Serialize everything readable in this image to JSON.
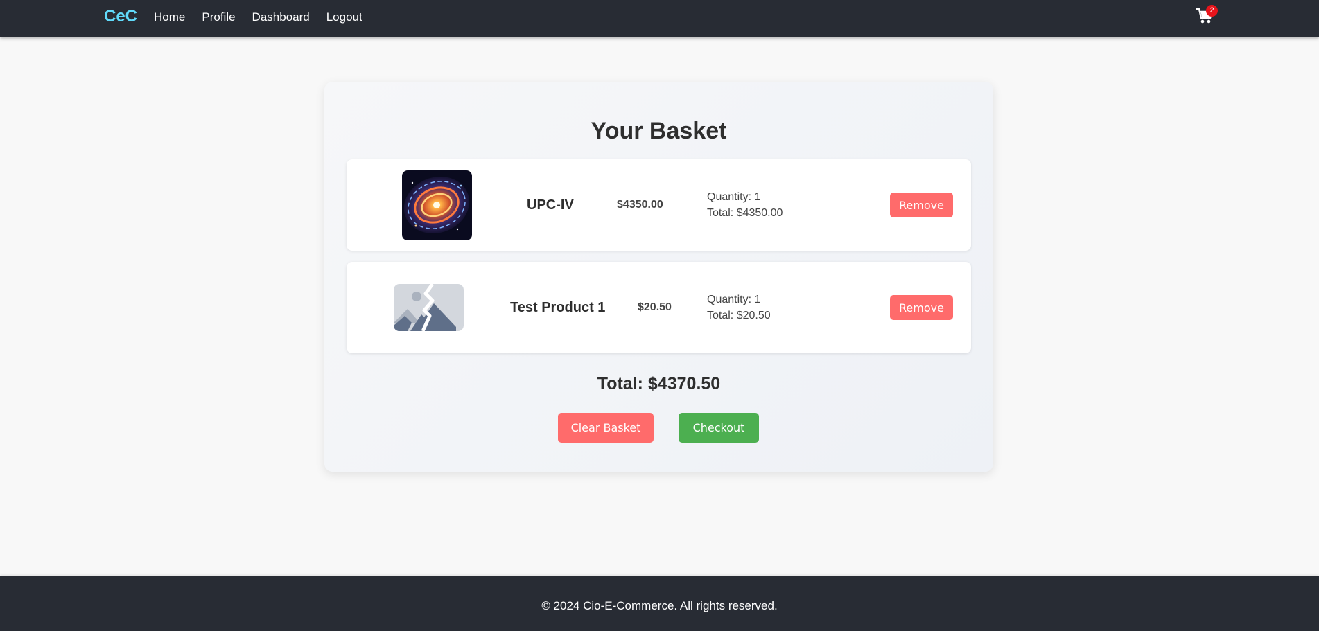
{
  "navbar": {
    "brand": "CeC",
    "links": [
      {
        "label": "Home"
      },
      {
        "label": "Profile"
      },
      {
        "label": "Dashboard"
      },
      {
        "label": "Logout"
      }
    ],
    "cart": {
      "icon": "shopping-cart-icon",
      "count": "2",
      "badge_color": "#e8141b"
    }
  },
  "basket": {
    "title": "Your Basket",
    "items": [
      {
        "name": "UPC-IV",
        "price": "$4350.00",
        "quantity": "Quantity: 1",
        "total": "Total: $4350.00",
        "image": "galaxy-image",
        "remove_label": "Remove"
      },
      {
        "name": "Test Product 1",
        "price": "$20.50",
        "quantity": "Quantity: 1",
        "total": "Total: $20.50",
        "image": "broken-image-icon",
        "remove_label": "Remove"
      }
    ],
    "grand_total": "Total: $4370.50",
    "clear_label": "Clear Basket",
    "checkout_label": "Checkout"
  },
  "footer": {
    "text": "© 2024 Cio-E-Commerce. All rights reserved."
  },
  "colors": {
    "nav_bg": "#282c34",
    "brand": "#61dafb",
    "danger": "#ff6b6b",
    "success": "#4caf50"
  }
}
